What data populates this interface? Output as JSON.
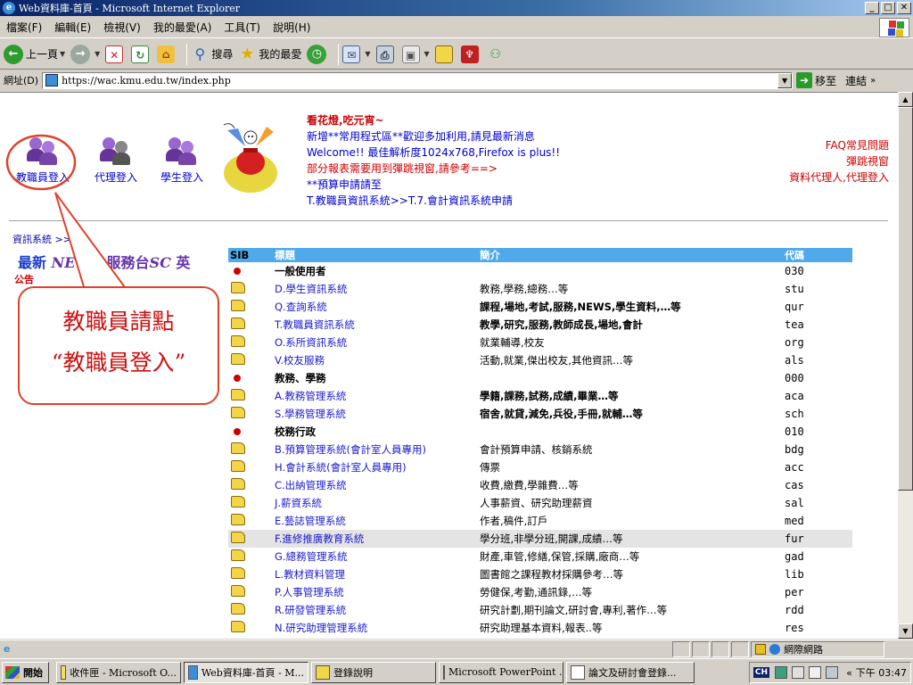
{
  "window": {
    "title": "Web資料庫-首頁 - Microsoft Internet Explorer",
    "min": "_",
    "max": "□",
    "close": "✕"
  },
  "menu": [
    "檔案(F)",
    "編輯(E)",
    "檢視(V)",
    "我的最愛(A)",
    "工具(T)",
    "說明(H)"
  ],
  "toolbar": {
    "back": "上一頁",
    "search": "搜尋",
    "favorites": "我的最愛"
  },
  "address": {
    "label": "網址(D)",
    "url": "https://wac.kmu.edu.tw/index.php",
    "go": "移至",
    "links": "連結"
  },
  "login": {
    "staff": "教職員登入",
    "proxy": "代理登入",
    "student": "學生登入"
  },
  "announce": {
    "heading": "看花燈,吃元宵~",
    "line1": "新增**常用程式區**歡迎多加利用,請見最新消息",
    "line2": "Welcome!! 最佳解析度1024x768,Firefox is plus!!",
    "line3": "部分報表需要用到彈跳視窗,請參考==>",
    "line4": "**預算申請請至",
    "line5": "T.教職員資訊系統>>T.7.會計資訊系統申請"
  },
  "right_links": {
    "faq": "FAQ常見問題",
    "popup": "彈跳視窗",
    "proxy": "資料代理人,代理登入"
  },
  "breadcrumb": "資訊系統 >>",
  "tabs": {
    "news": "最新",
    "news2": "NEWS",
    "desk": "服務台",
    "sc": "SC",
    "en": "英"
  },
  "notice": "公告",
  "callout": {
    "line1": "教職員請點",
    "line2": "“教職員登入”"
  },
  "table": {
    "headers": {
      "sib": "SIB",
      "title": "標題",
      "desc": "簡介",
      "code": "代碼"
    },
    "rows": [
      {
        "type": "cat",
        "title": "一般使用者",
        "desc": "",
        "code": "030"
      },
      {
        "type": "item",
        "title": "D.學生資訊系統",
        "desc": "教務,學務,總務…等",
        "code": "stu"
      },
      {
        "type": "item",
        "title": "Q.查詢系統",
        "desc": "課程,場地,考試,服務,NEWS,學生資料,…等",
        "code": "qur",
        "bold": true
      },
      {
        "type": "item",
        "title": "T.教職員資訊系統",
        "desc": "教學,研究,服務,教師成長,場地,會計",
        "code": "tea",
        "bold": true
      },
      {
        "type": "item",
        "title": "O.系所資訊系統",
        "desc": "就業輔導,校友",
        "code": "org"
      },
      {
        "type": "item",
        "title": "V.校友服務",
        "desc": "活動,就業,傑出校友,其他資訊…等",
        "code": "als"
      },
      {
        "type": "cat",
        "title": "教務、學務",
        "desc": "",
        "code": "000"
      },
      {
        "type": "item",
        "title": "A.教務管理系統",
        "desc": "學籍,課務,試務,成績,畢業…等",
        "code": "aca",
        "bold": true
      },
      {
        "type": "item",
        "title": "S.學務管理系統",
        "desc": "宿舍,就貸,減免,兵役,手冊,就輔…等",
        "code": "sch",
        "bold": true
      },
      {
        "type": "cat",
        "title": "校務行政",
        "desc": "",
        "code": "010"
      },
      {
        "type": "item",
        "title": "B.預算管理系統(會計室人員專用)",
        "desc": "會計預算申請、核銷系統",
        "code": "bdg"
      },
      {
        "type": "item",
        "title": "H.會計系統(會計室人員專用)",
        "desc": "傳票",
        "code": "acc"
      },
      {
        "type": "item",
        "title": "C.出納管理系統",
        "desc": "收費,繳費,學雜費…等",
        "code": "cas"
      },
      {
        "type": "item",
        "title": "J.薪資系統",
        "desc": "人事薪資、研究助理薪資",
        "code": "sal"
      },
      {
        "type": "item",
        "title": "E.藝誌管理系統",
        "desc": "作者,稿件,訂戶",
        "code": "med"
      },
      {
        "type": "item",
        "title": "F.進修推廣教育系統",
        "desc": "學分班,非學分班,開課,成績…等",
        "code": "fur",
        "highlight": true
      },
      {
        "type": "item",
        "title": "G.總務管理系統",
        "desc": "財產,車管,修繕,保管,採購,廠商…等",
        "code": "gad"
      },
      {
        "type": "item",
        "title": "L.教材資料管理",
        "desc": "圖書館之課程教材採購參考…等",
        "code": "lib"
      },
      {
        "type": "item",
        "title": "P.人事管理系統",
        "desc": "勞健保,考勤,通訊錄,…等",
        "code": "per"
      },
      {
        "type": "item",
        "title": "R.研發管理系統",
        "desc": "研究計劃,期刊論文,研討會,專利,著作…等",
        "code": "rdd"
      },
      {
        "type": "item",
        "title": "N.研究助理管理系統",
        "desc": "研究助理基本資料,報表..等",
        "code": "res"
      }
    ]
  },
  "status": {
    "zone": "網際網路"
  },
  "taskbar": {
    "start": "開始",
    "tasks": [
      "收件匣 - Microsoft O...",
      "Web資料庫-首頁 - M...",
      "登錄說明",
      "Microsoft PowerPoint ...",
      "論文及研討會登錄..."
    ],
    "ime": "CH",
    "clock": "下午 03:47"
  }
}
